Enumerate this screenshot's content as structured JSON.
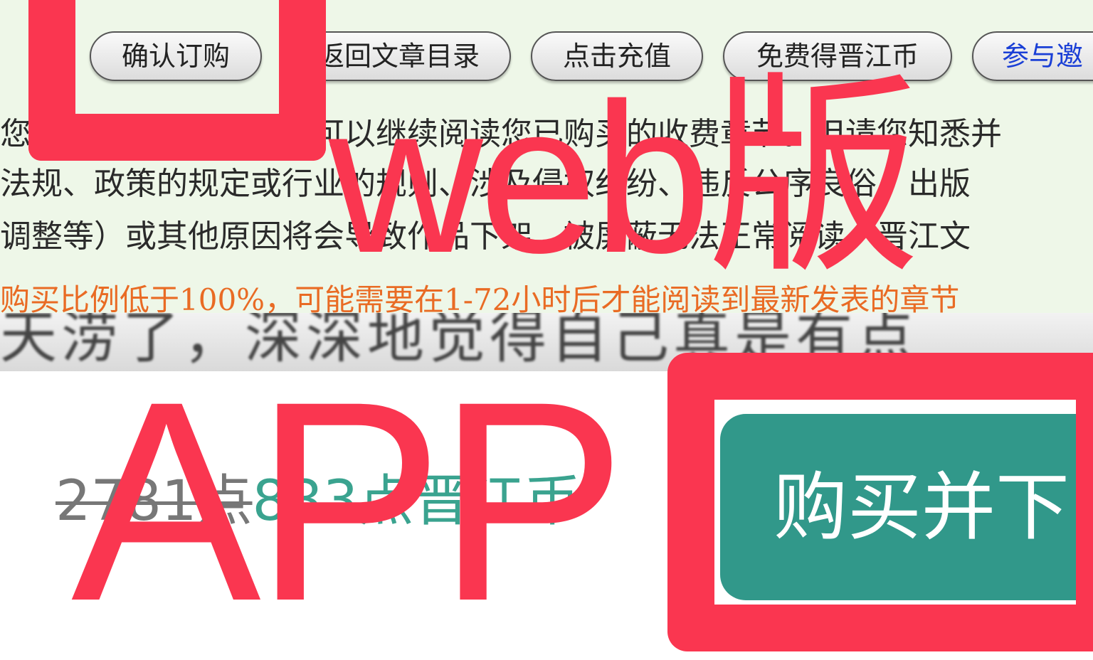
{
  "web": {
    "buttons": [
      {
        "label": "确认订购"
      },
      {
        "label": "返回文章目录"
      },
      {
        "label": "点击充值"
      },
      {
        "label": "免费得晋江币"
      },
      {
        "label": "参与邀"
      }
    ],
    "notice_lines": [
      "您如已购买本章节，您可以继续阅读您已购买的收费章节。但请您知悉并",
      "法规、政策的规定或行业的规则、涉及侵权纠纷、违反公序良俗、出版",
      "调整等）或其他原因将会导致作品下架、被屏蔽无法正常阅读，晋江文"
    ],
    "warning": "购买比例低于100%，可能需要在1-72小时后才能阅读到最新发表的章节",
    "scrolled_text": "天涝了，深深地觉得自己真是有点"
  },
  "app": {
    "old_price": "2781点",
    "new_price": "833点晋江币",
    "buy_button": "购买并下"
  },
  "overlay": {
    "web_label": "web版",
    "app_label": "APP",
    "accent_color": "#fa3650"
  }
}
